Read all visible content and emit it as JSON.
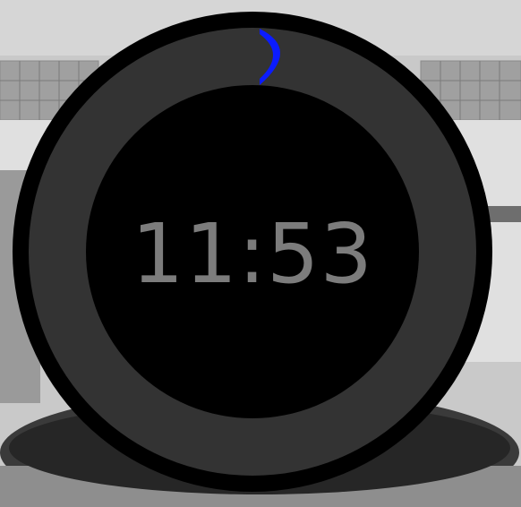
{
  "watch_face": {
    "time": "11:53",
    "progress_fraction": 0.09
  },
  "colors": {
    "bezel": "#000000",
    "ring_track": "#333333",
    "progress_arc": "#0b1cff",
    "face": "#000000",
    "time_text": "#7c7c7c"
  },
  "background": {
    "description_icon": "kitchen-pot-background"
  }
}
